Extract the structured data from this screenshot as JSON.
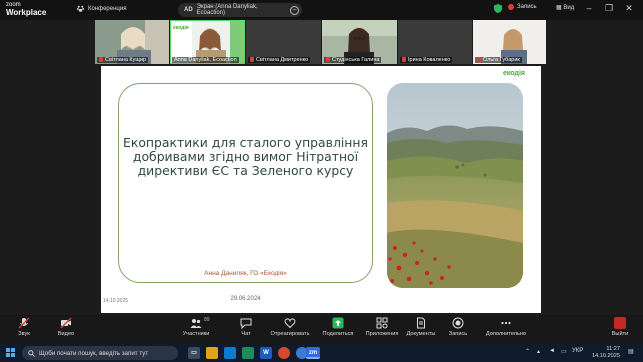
{
  "app": {
    "logo_line1": "zoom",
    "logo_line2": "Workplace"
  },
  "titlebar": {
    "conference_label": "Конференция",
    "share_initials": "AD",
    "share_label": "Экран (Anna Danyliak, Ecoaction)",
    "record_label": "Запись",
    "view_label": "Вид",
    "minimize": "–",
    "maximize": "❐",
    "close": "✕"
  },
  "gallery": {
    "participants": [
      {
        "name": "Світлана Кущир",
        "muted": true
      },
      {
        "name": "Anna Danyliak, Ecoaction",
        "muted": false,
        "active": true
      },
      {
        "name": "Світлана Дмитренко",
        "muted": true
      },
      {
        "name": "Студінська Галина",
        "muted": true
      },
      {
        "name": "Ірина Коваленко",
        "muted": true
      },
      {
        "name": "Ольга Губарик",
        "muted": true
      }
    ],
    "prev_arrow": "‹",
    "next_arrow": "›"
  },
  "slide": {
    "logo": "екодія",
    "title": "Екопрактики для сталого управління добривами згідно вимог Нітратної директиви ЄС та Зеленого курсу",
    "author": "Анна Даниляк, ГО «Екодія»",
    "date": "29.06.2024",
    "footer_date": "14.10.2025"
  },
  "toolbar": {
    "audio": "Звук",
    "video": "Видео",
    "participants": "Участники",
    "participants_count": "89",
    "chat": "Чат",
    "react": "Отреагировать",
    "share": "Поделиться",
    "apps": "Приложения",
    "docs": "Документы",
    "record": "Запись",
    "more": "Дополнительно",
    "leave": "Выйти"
  },
  "taskbar": {
    "search_placeholder": "Щоби почати пошук, введіть запит тут",
    "zoom_icon_text": "zm",
    "word_icon_text": "W",
    "lang": "УКР",
    "time": "11:27",
    "date": "14.10.2025"
  },
  "colors": {
    "brand_green": "#4aa63a",
    "title_color": "#2c4a3a",
    "author_color": "#b0532a",
    "leave_red": "#c62828"
  }
}
